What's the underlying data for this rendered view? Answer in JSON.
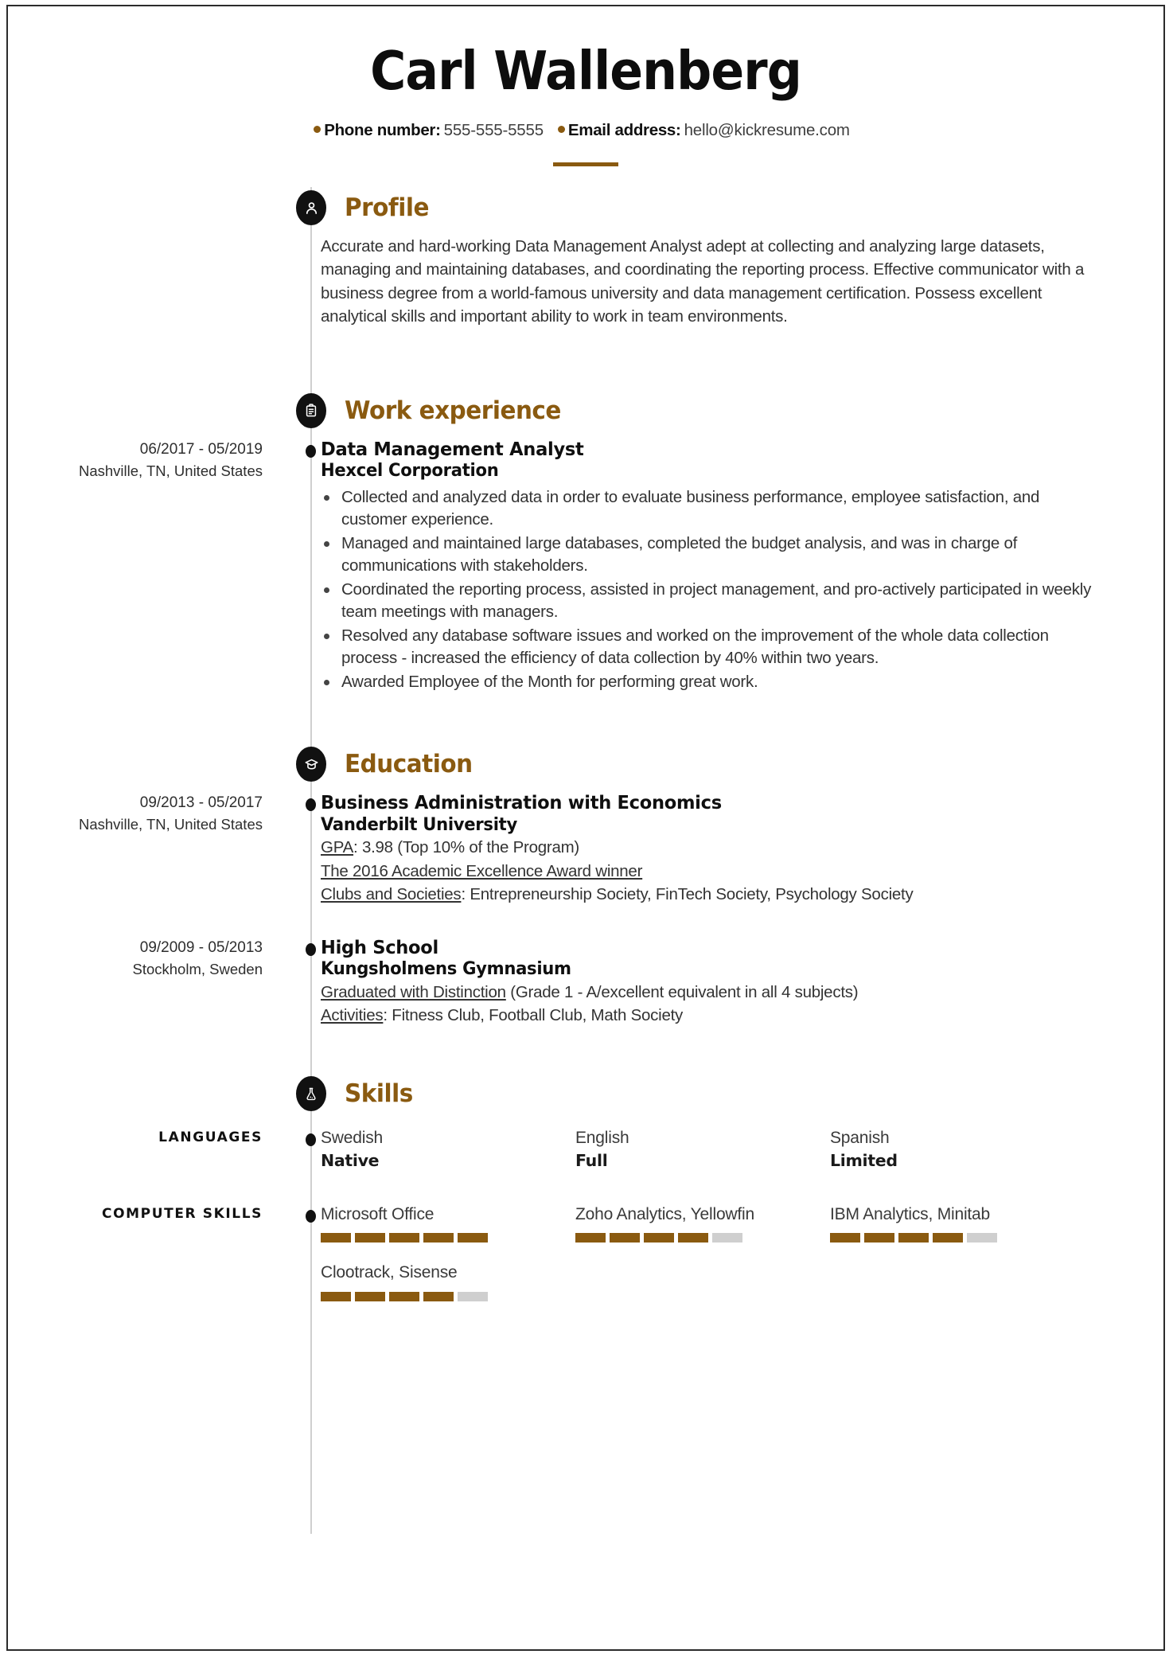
{
  "theme": {
    "accent": "#8a5a10",
    "ink": "#0f0f0f",
    "muted": "#cfcfcf"
  },
  "header": {
    "name": "Carl Wallenberg",
    "contacts": [
      {
        "label": "Phone number:",
        "value": "555-555-5555"
      },
      {
        "label": "Email address:",
        "value": "hello@kickresume.com"
      }
    ]
  },
  "sections": {
    "profile": {
      "title": "Profile",
      "icon": "person-icon",
      "text": "Accurate and hard-working Data Management Analyst adept at collecting and analyzing large datasets, managing and maintaining databases, and coordinating the reporting process. Effective communicator with a business degree from a world-famous university and data management certification. Possess excellent analytical skills and important ability to work in team environments."
    },
    "work": {
      "title": "Work experience",
      "icon": "briefcase-icon",
      "entries": [
        {
          "dates": "06/2017 - 05/2019",
          "location": "Nashville, TN, United States",
          "role": "Data Management Analyst",
          "company": "Hexcel Corporation",
          "bullets": [
            "Collected and analyzed data in order to evaluate business performance, employee satisfaction, and customer experience.",
            "Managed and maintained large databases, completed the budget analysis, and was in charge of communications with stakeholders.",
            "Coordinated the reporting process, assisted in project management, and pro-actively participated in weekly team meetings with managers.",
            "Resolved any database software issues and worked on the improvement of the whole data collection process - increased the efficiency of data collection by 40% within two years.",
            "Awarded Employee of the Month for performing great work."
          ]
        }
      ]
    },
    "education": {
      "title": "Education",
      "icon": "graduation-cap-icon",
      "entries": [
        {
          "dates": "09/2013 - 05/2017",
          "location": "Nashville, TN, United States",
          "degree": "Business Administration with Economics",
          "school": "Vanderbilt University",
          "details": [
            {
              "label": "GPA",
              "sep": ": ",
              "value": "3.98 (Top 10% of the Program)"
            },
            {
              "label": "The 2016 Academic Excellence Award winner",
              "sep": "",
              "value": ""
            },
            {
              "label": "Clubs and Societies",
              "sep": ": ",
              "value": "Entrepreneurship Society, FinTech Society, Psychology Society"
            }
          ]
        },
        {
          "dates": "09/2009 - 05/2013",
          "location": "Stockholm, Sweden",
          "degree": "High School",
          "school": "Kungsholmens Gymnasium",
          "details": [
            {
              "label": "Graduated with Distinction",
              "sep": " ",
              "value": "(Grade 1 - A/excellent equivalent in all 4 subjects)"
            },
            {
              "label": "Activities",
              "sep": ": ",
              "value": "Fitness Club, Football Club, Math Society"
            }
          ]
        }
      ]
    },
    "skills": {
      "title": "Skills",
      "icon": "flask-icon",
      "groups": [
        {
          "label": "LANGUAGES",
          "type": "languages",
          "items": [
            {
              "name": "Swedish",
              "level": "Native"
            },
            {
              "name": "English",
              "level": "Full"
            },
            {
              "name": "Spanish",
              "level": "Limited"
            }
          ]
        },
        {
          "label": "COMPUTER SKILLS",
          "type": "rated",
          "max": 5,
          "items": [
            {
              "name": "Microsoft Office",
              "score": 5
            },
            {
              "name": "Zoho Analytics, Yellowfin",
              "score": 4
            },
            {
              "name": "IBM Analytics, Minitab",
              "score": 4
            },
            {
              "name": "Clootrack, Sisense",
              "score": 4
            }
          ]
        }
      ]
    }
  }
}
